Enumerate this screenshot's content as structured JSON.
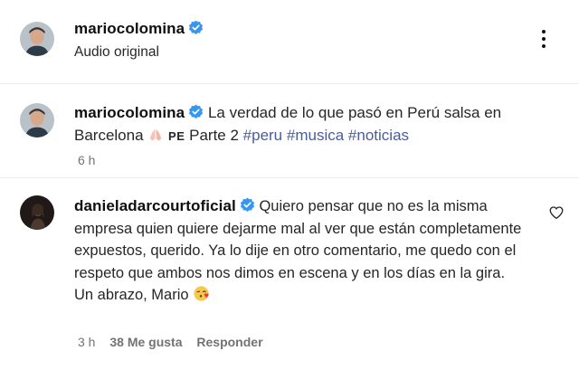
{
  "header": {
    "username": "mariocolomina",
    "subtitle": "Audio original"
  },
  "caption": {
    "username": "mariocolomina",
    "text_part1": "La verdad de lo que pasó en Perú salsa en Barcelona",
    "emoji_1": "pray-hands",
    "flag": "PE",
    "text_part2": "Parte 2",
    "hashtags": [
      "#peru",
      "#musica",
      "#noticias"
    ],
    "time": "6 h"
  },
  "comment": {
    "username": "danieladarcourtoficial",
    "text": "Quiero pensar que no es la misma empresa quien quiere dejarme mal al ver que están completamente expuestos, querido. Ya lo dije en otro comentario, me quedo con el respeto que ambos nos dimos en escena y en los días en la gira.",
    "signoff": "Un abrazo, Mario",
    "emoji_2": "face-blowing-kiss",
    "time": "3 h",
    "likes": "38 Me gusta",
    "reply_label": "Responder"
  },
  "colors": {
    "verified": "#3797f0",
    "hashtag": "#4a5d9e",
    "meta": "#737373"
  },
  "icons": [
    "verified-badge-icon",
    "more-options-icon",
    "heart-outline-icon"
  ]
}
